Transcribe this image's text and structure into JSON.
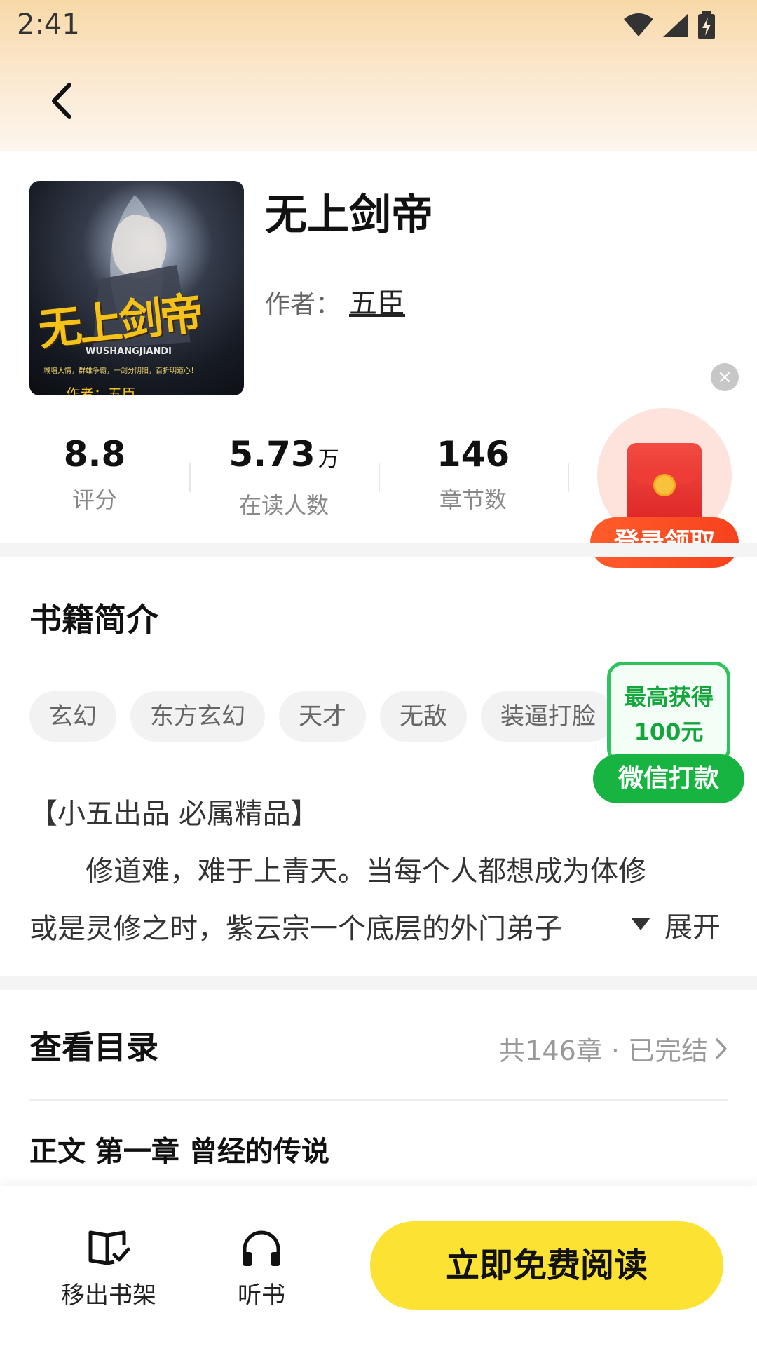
{
  "status_bar": {
    "time": "2:41"
  },
  "book": {
    "title": "无上剑帝",
    "author_label": "作者：",
    "author": "五臣",
    "cover": {
      "title_art": "无上剑帝",
      "subtitle": "WUSHANGJIANDI",
      "tagline": "城墙大情，群雄争霸，一剑分阴阳，百折明道心！",
      "author_line": "作者：五臣"
    }
  },
  "stats": [
    {
      "value": "8.8",
      "unit": "",
      "label": "评分"
    },
    {
      "value": "5.73",
      "unit": "万",
      "label": "在读人数"
    },
    {
      "value": "146",
      "unit": "",
      "label": "章节数"
    }
  ],
  "promo": {
    "login_claim": "登录领取"
  },
  "intro": {
    "section_title": "书籍简介",
    "tags": [
      "玄幻",
      "东方玄幻",
      "天才",
      "无敌",
      "装逼打脸"
    ],
    "lines": [
      "【小五出品 必属精品】",
      "　　修道难，难于上青天。当每个人都想成为体修",
      "或是灵修之时，紫云宗一个底层的外门弟子"
    ],
    "expand_label": "展开"
  },
  "wechat_promo": {
    "line1": "最高获得",
    "line2": "100元",
    "button": "微信打款"
  },
  "catalog": {
    "title": "查看目录",
    "meta": "共146章 · 已完结",
    "first_chapter": "正文 第一章 曾经的传说"
  },
  "bottom_bar": {
    "shelf_label": "移出书架",
    "listen_label": "听书",
    "read_button": "立即免费阅读"
  },
  "colors": {
    "accent_yellow": "#FBE233",
    "promo_orange": "#F7421D",
    "wechat_green": "#17B441",
    "header_gradient_top": "#F8D9A8"
  }
}
